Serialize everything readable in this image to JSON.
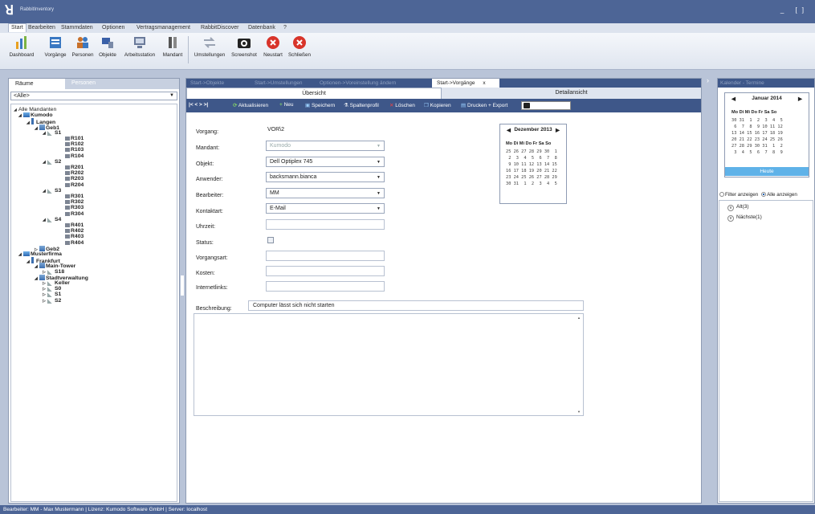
{
  "window": {
    "title": "RabbitInventory",
    "controls": "_ []"
  },
  "menu": [
    "Start",
    "Bearbeiten",
    "Stammdaten",
    "Optionen",
    "Vertragsmanagement",
    "RabbitDiscover",
    "Datenbank",
    "?"
  ],
  "ribbon": {
    "buttons": [
      "Dashboard",
      "Vorgänge",
      "Personen",
      "Objekte",
      "Arbeitsstation",
      "Mandant",
      "Umstellungen",
      "Screenshot",
      "Neustart",
      "Schließen"
    ],
    "colors": {
      "dashboard": "#e8a020",
      "vorgange": "#3a78c2",
      "personen": "#c8702a",
      "objekte": "#3a60a8",
      "umstellungen": "#9aa3b3",
      "red": "#d8342a"
    }
  },
  "left": {
    "tabs": [
      "Räume",
      "Personen"
    ],
    "filter": "<Alle>",
    "tree": [
      {
        "label": "Alle Mandanten",
        "ex": "◢",
        "icon": "",
        "depth": 0,
        "bold": false
      },
      {
        "label": "Kumodo",
        "ex": "◢",
        "icon": "org",
        "depth": 1,
        "bold": true
      },
      {
        "label": "Langen",
        "ex": "◢",
        "icon": "city",
        "depth": 2,
        "bold": true
      },
      {
        "label": "Geb1",
        "ex": "◢",
        "icon": "bldg",
        "depth": 3,
        "bold": true
      },
      {
        "label": "S1",
        "ex": "◢",
        "icon": "floor",
        "depth": 4,
        "bold": true
      },
      {
        "label": "R101",
        "ex": "",
        "icon": "room",
        "depth": 5,
        "bold": true
      },
      {
        "label": "R102",
        "ex": "",
        "icon": "room",
        "depth": 5,
        "bold": true
      },
      {
        "label": "R103",
        "ex": "",
        "icon": "room",
        "depth": 5,
        "bold": true
      },
      {
        "label": "R104",
        "ex": "",
        "icon": "room",
        "depth": 5,
        "bold": true
      },
      {
        "label": "S2",
        "ex": "◢",
        "icon": "floor",
        "depth": 4,
        "bold": true
      },
      {
        "label": "R201",
        "ex": "",
        "icon": "room",
        "depth": 5,
        "bold": true
      },
      {
        "label": "R202",
        "ex": "",
        "icon": "room",
        "depth": 5,
        "bold": true
      },
      {
        "label": "R203",
        "ex": "",
        "icon": "room",
        "depth": 5,
        "bold": true
      },
      {
        "label": "R204",
        "ex": "",
        "icon": "room",
        "depth": 5,
        "bold": true
      },
      {
        "label": "S3",
        "ex": "◢",
        "icon": "floor",
        "depth": 4,
        "bold": true
      },
      {
        "label": "R301",
        "ex": "",
        "icon": "room",
        "depth": 5,
        "bold": true
      },
      {
        "label": "R302",
        "ex": "",
        "icon": "room",
        "depth": 5,
        "bold": true
      },
      {
        "label": "R303",
        "ex": "",
        "icon": "room",
        "depth": 5,
        "bold": true
      },
      {
        "label": "R304",
        "ex": "",
        "icon": "room",
        "depth": 5,
        "bold": true
      },
      {
        "label": "S4",
        "ex": "◢",
        "icon": "floor",
        "depth": 4,
        "bold": true
      },
      {
        "label": "R401",
        "ex": "",
        "icon": "room",
        "depth": 5,
        "bold": true
      },
      {
        "label": "R402",
        "ex": "",
        "icon": "room",
        "depth": 5,
        "bold": true
      },
      {
        "label": "R403",
        "ex": "",
        "icon": "room",
        "depth": 5,
        "bold": true
      },
      {
        "label": "R404",
        "ex": "",
        "icon": "room",
        "depth": 5,
        "bold": true
      },
      {
        "label": "Geb2",
        "ex": "▷",
        "icon": "bldg",
        "depth": 3,
        "bold": true
      },
      {
        "label": "Musterfirma",
        "ex": "◢",
        "icon": "org",
        "depth": 1,
        "bold": true
      },
      {
        "label": "Frankfurt",
        "ex": "◢",
        "icon": "city",
        "depth": 2,
        "bold": true
      },
      {
        "label": "Main-Tower",
        "ex": "◢",
        "icon": "bldg",
        "depth": 3,
        "bold": true
      },
      {
        "label": "S18",
        "ex": "▷",
        "icon": "floor",
        "depth": 4,
        "bold": true
      },
      {
        "label": "Stadtverwaltung",
        "ex": "◢",
        "icon": "bldg",
        "depth": 3,
        "bold": true
      },
      {
        "label": "Keller",
        "ex": "▷",
        "icon": "floor",
        "depth": 4,
        "bold": true
      },
      {
        "label": "S0",
        "ex": "▷",
        "icon": "floor",
        "depth": 4,
        "bold": true
      },
      {
        "label": "S1",
        "ex": "▷",
        "icon": "floor",
        "depth": 4,
        "bold": true
      },
      {
        "label": "S2",
        "ex": "▷",
        "icon": "floor",
        "depth": 4,
        "bold": true
      }
    ]
  },
  "center": {
    "tabs": [
      "Start->Objekte",
      "Start->Umstellungen",
      "Optionen->Voreinstellung ändern",
      "Start->Vorgänge"
    ],
    "active_tab_close": "x",
    "subtabs": [
      "Übersicht",
      "Detailansicht"
    ],
    "toolbar": {
      "nav": "|< < > >|",
      "aktualisieren": "Aktualisieren",
      "neu": "Neu",
      "speichern": "Speichern",
      "spaltenprofil": "Spaltenprofil",
      "loeschen": "Löschen",
      "kopieren": "Kopieren",
      "drucken": "Drucken + Export"
    },
    "form": {
      "vorgang_label": "Vorgang:",
      "vorgang_value": "VOR\\2",
      "mandant_label": "Mandant:",
      "mandant_value": "Kumodo",
      "objekt_label": "Objekt:",
      "objekt_value": "Dell Optiplex 745",
      "anwender_label": "Anwender:",
      "anwender_value": "backsmann.bianca",
      "bearbeiter_label": "Bearbeiter:",
      "bearbeiter_value": "MM",
      "kontaktart_label": "Kontaktart:",
      "kontaktart_value": "E-Mail",
      "uhrzeit_label": "Uhrzeit:",
      "status_label": "Status:",
      "vorgangsart_label": "Vorgangsart:",
      "kosten_label": "Kosten:",
      "internetlinks_label": "Internetlinks:",
      "beschreibung_label": "Beschreibung:",
      "beschreibung_value": "Computer lässt sich nicht starten"
    },
    "calendar": {
      "title": "Dezember 2013",
      "prev": "◀",
      "next": "▶",
      "dow": "Mo Di Mi Do Fr Sa So",
      "weeks": [
        "25 26 27 28 29 30  1",
        " 2  3  4  5  6  7  8",
        " 9 10 11 12 13 14 15",
        "16 17 18 19 20 21 22",
        "23 24 25 26 27 28 29",
        "30 31  1  2  3  4  5"
      ]
    }
  },
  "right": {
    "title": "Kalender - Termine",
    "calendar": {
      "title": "Januar 2014",
      "prev": "◀",
      "next": "▶",
      "dow": "Mo Di Mi Do Fr Sa So",
      "weeks": [
        "30 31  1  2  3  4  5",
        " 6  7  8  9 10 11 12",
        "13 14 15 16 17 18 19",
        "20 21 22 23 24 25 26",
        "27 28 29 30 31  1  2",
        " 3  4  5  6  7  8  9"
      ],
      "today": "Heute"
    },
    "filter_on": "Filter anzeigen",
    "filter_all": "Alle anzeigen",
    "nodes": [
      "Alt(3)",
      "Nächste(1)"
    ]
  },
  "statusbar": "Bearbeiter: MM - Max Mustermann  |  Lizenz: Kumodo Software GmbH  |  Server: localhost"
}
